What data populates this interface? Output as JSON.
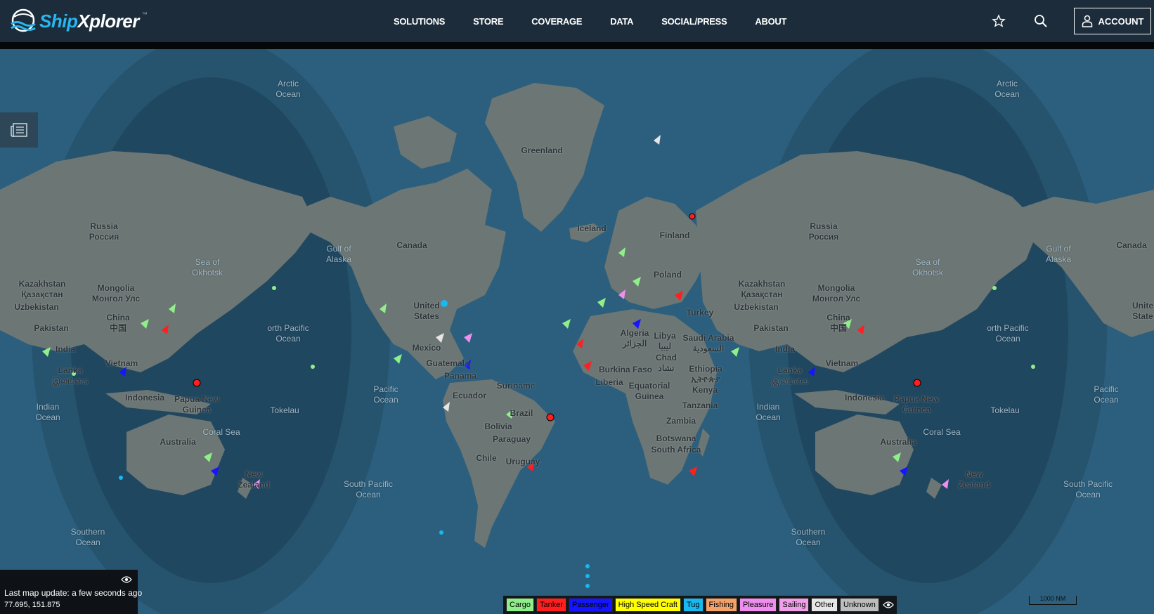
{
  "brand": {
    "name_prefix": "Ship",
    "name_x": "Xplorer",
    "tm": "™"
  },
  "nav": [
    "SOLUTIONS",
    "STORE",
    "COVERAGE",
    "DATA",
    "SOCIAL/PRESS",
    "ABOUT"
  ],
  "account_label": "ACCOUNT",
  "icons": {
    "favorite": "star-icon",
    "search": "search-icon",
    "account": "user-icon",
    "panel": "news-panel-icon",
    "visibility": "eye-icon"
  },
  "status": {
    "last_update": "Last map update: a few seconds ago",
    "coords": "77.695, 151.875"
  },
  "legend": [
    {
      "label": "Cargo",
      "color": "#8ff08a"
    },
    {
      "label": "Tanker",
      "color": "#ff1f1f"
    },
    {
      "label": "Passenger",
      "color": "#1515ff"
    },
    {
      "label": "High Speed Craft",
      "color": "#ffff00"
    },
    {
      "label": "Tug",
      "color": "#18b8f0"
    },
    {
      "label": "Fishing",
      "color": "#f5a26a"
    },
    {
      "label": "Pleasure",
      "color": "#f08ef0"
    },
    {
      "label": "Sailing",
      "color": "#f0a0e8"
    },
    {
      "label": "Other",
      "color": "#e6e6e6"
    },
    {
      "label": "Unknown",
      "color": "#bdbdbd"
    }
  ],
  "scale": "1000 NM",
  "map_labels": [
    {
      "text": "Arctic\nOcean",
      "kind": "ocean"
    },
    {
      "text": "Greenland",
      "kind": "land"
    },
    {
      "text": "Iceland",
      "kind": "land"
    },
    {
      "text": "Arctic\nOcean",
      "kind": "ocean"
    },
    {
      "text": "Russia\nРоссия",
      "kind": "land"
    },
    {
      "text": "Canada",
      "kind": "land"
    },
    {
      "text": "Gulf of\nAlaska",
      "kind": "ocean"
    },
    {
      "text": "Sea of\nOkhotsk",
      "kind": "ocean"
    },
    {
      "text": "Kazakhstan\nҚазақстан",
      "kind": "land"
    },
    {
      "text": "Mongolia\nМонгол Улс",
      "kind": "land"
    },
    {
      "text": "Uzbekistan",
      "kind": "land"
    },
    {
      "text": "China\n中国",
      "kind": "land"
    },
    {
      "text": "Pakistan",
      "kind": "land"
    },
    {
      "text": "India",
      "kind": "land"
    },
    {
      "text": "orth Pacific\nOcean",
      "kind": "ocean"
    },
    {
      "text": "United\nStates",
      "kind": "land"
    },
    {
      "text": "Mexico",
      "kind": "land"
    },
    {
      "text": "Guatemala",
      "kind": "land"
    },
    {
      "text": "Lanka\nஇலங்கை",
      "kind": "land"
    },
    {
      "text": "Vietnam",
      "kind": "land"
    },
    {
      "text": "Indonesia",
      "kind": "land"
    },
    {
      "text": "Papua New\nGuinea",
      "kind": "land"
    },
    {
      "text": "Tokelau",
      "kind": "ocean"
    },
    {
      "text": "Pacific\nOcean",
      "kind": "ocean"
    },
    {
      "text": "Indian\nOcean",
      "kind": "ocean"
    },
    {
      "text": "Australia",
      "kind": "land"
    },
    {
      "text": "Coral Sea",
      "kind": "ocean"
    },
    {
      "text": "New\nZealand",
      "kind": "land"
    },
    {
      "text": "South Pacific\nOcean",
      "kind": "ocean"
    },
    {
      "text": "Southern\nOcean",
      "kind": "ocean"
    },
    {
      "text": "Panama",
      "kind": "land"
    },
    {
      "text": "Suriname",
      "kind": "land"
    },
    {
      "text": "Ecuador",
      "kind": "land"
    },
    {
      "text": "Brazil",
      "kind": "land"
    },
    {
      "text": "Bolivia",
      "kind": "land"
    },
    {
      "text": "Paraguay",
      "kind": "land"
    },
    {
      "text": "Chile",
      "kind": "land"
    },
    {
      "text": "Uruguay",
      "kind": "land"
    },
    {
      "text": "Finland",
      "kind": "land"
    },
    {
      "text": "Poland",
      "kind": "land"
    },
    {
      "text": "Turkey",
      "kind": "land"
    },
    {
      "text": "Algeria\nالجزائر",
      "kind": "land"
    },
    {
      "text": "Libya\nليبيا",
      "kind": "land"
    },
    {
      "text": "Saudi Arabia\nالسعودية",
      "kind": "land"
    },
    {
      "text": "Chad\nتشاد",
      "kind": "land"
    },
    {
      "text": "Burkina Faso",
      "kind": "land"
    },
    {
      "text": "Liberia",
      "kind": "land"
    },
    {
      "text": "Ethiopia\nኢትዮጵያ",
      "kind": "land"
    },
    {
      "text": "Equatorial\nGuinea",
      "kind": "land"
    },
    {
      "text": "Kenya",
      "kind": "land"
    },
    {
      "text": "Tanzania",
      "kind": "land"
    },
    {
      "text": "Zambia",
      "kind": "land"
    },
    {
      "text": "Botswana",
      "kind": "land"
    },
    {
      "text": "South Africa",
      "kind": "land"
    },
    {
      "text": "Russia\nРоссия",
      "kind": "land"
    },
    {
      "text": "Canada",
      "kind": "land"
    },
    {
      "text": "Gulf of\nAlaska",
      "kind": "ocean"
    },
    {
      "text": "Sea of\nOkhotsk",
      "kind": "ocean"
    },
    {
      "text": "Kazakhstan\nҚазақстан",
      "kind": "land"
    },
    {
      "text": "Mongolia\nМонгол Улс",
      "kind": "land"
    },
    {
      "text": "Uzbekistan",
      "kind": "land"
    },
    {
      "text": "China\n中国",
      "kind": "land"
    },
    {
      "text": "Pakistan",
      "kind": "land"
    },
    {
      "text": "India",
      "kind": "land"
    },
    {
      "text": "orth Pacific\nOcean",
      "kind": "ocean"
    },
    {
      "text": "Unite\nState",
      "kind": "land"
    },
    {
      "text": "Lanka\nஇலங்கை",
      "kind": "land"
    },
    {
      "text": "Vietnam",
      "kind": "land"
    },
    {
      "text": "Indonesia",
      "kind": "land"
    },
    {
      "text": "Papua New\nGuinea",
      "kind": "land"
    },
    {
      "text": "Tokelau",
      "kind": "ocean"
    },
    {
      "text": "Pacific\nOcean",
      "kind": "ocean"
    },
    {
      "text": "Indian\nOcean",
      "kind": "ocean"
    },
    {
      "text": "Australia",
      "kind": "land"
    },
    {
      "text": "Coral Sea",
      "kind": "ocean"
    },
    {
      "text": "New\nZealand",
      "kind": "land"
    },
    {
      "text": "South Pacific\nOcean",
      "kind": "ocean"
    },
    {
      "text": "Southern\nOcean",
      "kind": "ocean"
    }
  ]
}
